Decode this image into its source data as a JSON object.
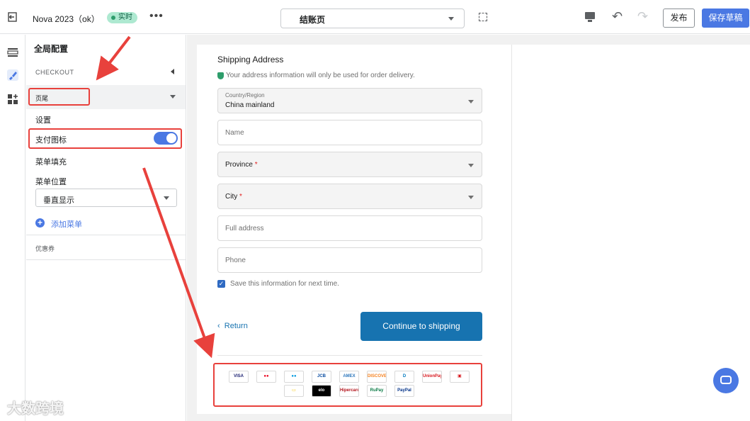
{
  "topbar": {
    "store_name": "Nova 2023（ok）",
    "live_badge": "实时",
    "more": "•••",
    "page_select": "结账页",
    "publish_label": "发布",
    "save_draft_label": "保存草稿"
  },
  "panel": {
    "title": "全局配置",
    "section_label": "CHECKOUT",
    "footer_row": "页尾",
    "settings_label": "设置",
    "payment_icons_label": "支付图标",
    "payment_icons_enabled": true,
    "menu_fill_label": "菜单填充",
    "menu_position_label": "菜单位置",
    "menu_position_value": "垂直显示",
    "add_menu_label": "添加菜单",
    "coupon_label": "优惠券"
  },
  "checkout": {
    "heading": "Shipping Address",
    "note": "Your address information will only be used for order delivery.",
    "country_label": "Country/Region",
    "country_value": "China mainland",
    "name_placeholder": "Name",
    "province_placeholder": "Province",
    "city_placeholder": "City",
    "required_mark": "*",
    "address_placeholder": "Full address",
    "phone_placeholder": "Phone",
    "save_info_label": "Save this information for next time.",
    "save_info_checked": true,
    "return_label": "Return",
    "return_chevron": "‹",
    "continue_label": "Continue to shipping",
    "payment_icons": [
      {
        "label": "VISA",
        "color": "#1a1f71"
      },
      {
        "label": "●●",
        "color": "#eb001b"
      },
      {
        "label": "●●",
        "color": "#0099df"
      },
      {
        "label": "JCB",
        "color": "#0b4ea2"
      },
      {
        "label": "AMEX",
        "color": "#2e77bc"
      },
      {
        "label": "DISCOVER",
        "color": "#f58220"
      },
      {
        "label": "D",
        "color": "#0079be"
      },
      {
        "label": "UnionPay",
        "color": "#d7161c"
      },
      {
        "label": "▣",
        "color": "#d7161c"
      },
      {
        "label": "▭",
        "color": "#f5c400"
      },
      {
        "label": "elo",
        "color": "#000000"
      },
      {
        "label": "Hipercard",
        "color": "#b3131b"
      },
      {
        "label": "RuPay",
        "color": "#097a44"
      },
      {
        "label": "PayPal",
        "color": "#003087"
      }
    ]
  },
  "watermark": "大数跨境",
  "colors": {
    "primary": "#4a78e3",
    "checkout_blue": "#1773b0",
    "annotation_red": "#e8413c",
    "live_green": "#aee9d1"
  }
}
